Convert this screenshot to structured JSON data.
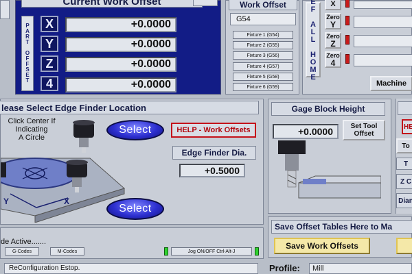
{
  "work_offset_panel": {
    "title": "Current Work Offset",
    "side_label": "PART OFFSET",
    "axes": [
      {
        "label": "X",
        "value": "+0.0000"
      },
      {
        "label": "Y",
        "value": "+0.0000"
      },
      {
        "label": "Z",
        "value": "+0.0000"
      },
      {
        "label": "4",
        "value": "+0.0000"
      }
    ]
  },
  "fixture_panel": {
    "title": "Work Offset",
    "current": "G54",
    "fixtures": [
      "Fixture 1 (G54)",
      "Fixture 2 (G55)",
      "Fixture 3 (G56)",
      "Fixture 4 (G57)",
      "Fixture 5 (G58)",
      "Fixture 6 (G59)"
    ]
  },
  "ref_panel": {
    "side_label": "REF ALL HOME",
    "zero_buttons": [
      {
        "top": "",
        "axis": "X"
      },
      {
        "top": "Zero",
        "axis": "Y"
      },
      {
        "top": "Zero",
        "axis": "Z"
      },
      {
        "top": "Zero",
        "axis": "4"
      }
    ],
    "machine_button": "Machine"
  },
  "edge_finder": {
    "title": "lease Select Edge Finder Location",
    "hint_line1": "Click Center If",
    "hint_line2": "Indicating",
    "hint_line3": "A Circle",
    "select_label": "Select",
    "help_button": "HELP - Work Offsets",
    "dia_label": "Edge Finder Dia.",
    "dia_value": "+0.5000",
    "axis_y": "Y",
    "axis_x": "X"
  },
  "gage_block": {
    "title": "Gage Block Height",
    "value": "+0.0000",
    "set_tool_line1": "Set Tool",
    "set_tool_line2": "Offset"
  },
  "right_edge": {
    "btn_red": "HE",
    "btn_to": "To",
    "btn_t": "T",
    "btn_z": "Z C",
    "btn_dia": "Dian"
  },
  "save_panel": {
    "title": "Save Offset Tables Here to Ma",
    "button": "Save Work Offsets"
  },
  "mode_panel": {
    "label": "de Active.......",
    "gcodes": "G-Codes",
    "mcodes": "M-Codes",
    "jog": "Jog ON/OFF Ctrl-Alt-J"
  },
  "status_bar": {
    "message": "ReConfiguration Estop.",
    "profile_label": "Profile:",
    "profile_value": "Mill"
  }
}
